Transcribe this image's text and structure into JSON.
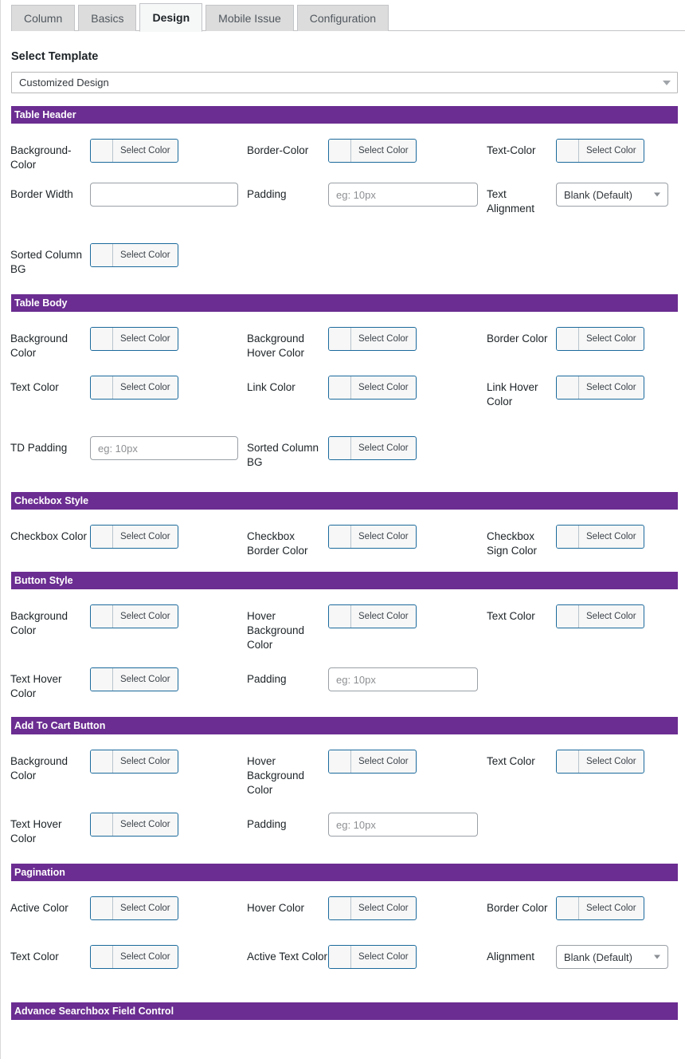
{
  "tabs": [
    {
      "label": "Column",
      "active": false
    },
    {
      "label": "Basics",
      "active": false
    },
    {
      "label": "Design",
      "active": true
    },
    {
      "label": "Mobile Issue",
      "active": false
    },
    {
      "label": "Configuration",
      "active": false
    }
  ],
  "select_template": {
    "heading": "Select Template",
    "value": "Customized Design",
    "caret_icon": "chevron-down-icon"
  },
  "common": {
    "select_color": "Select Color",
    "padding_placeholder": "eg: 10px",
    "blank_default": "Blank (Default)",
    "empty": ""
  },
  "colors": {
    "section_bar_bg": "#6b2d91",
    "section_bar_text": "#ffffff",
    "colorbtn_border": "#1b6a9c",
    "tab_active_bg": "#f6f7f7",
    "tab_inactive_bg": "#dcdcdc"
  },
  "sections": [
    {
      "title": "Table Header",
      "fields": [
        "Background-Color",
        "Border-Color",
        "Text-Color",
        "Border Width",
        "Padding",
        "Text Alignment",
        "Sorted Column BG"
      ]
    },
    {
      "title": "Table Body",
      "fields": [
        "Background Color",
        "Background Hover Color",
        "Border Color",
        "Text Color",
        "Link Color",
        "Link Hover Color",
        "TD Padding",
        "Sorted Column BG"
      ]
    },
    {
      "title": "Checkbox Style",
      "fields": [
        "Checkbox Color",
        "Checkbox Border Color",
        "Checkbox Sign Color"
      ]
    },
    {
      "title": "Button Style",
      "fields": [
        "Background Color",
        "Hover Background Color",
        "Text Color",
        "Text Hover Color",
        "Padding"
      ]
    },
    {
      "title": "Add To Cart Button",
      "fields": [
        "Background Color",
        "Hover Background Color",
        "Text Color",
        "Text Hover Color",
        "Padding"
      ]
    },
    {
      "title": "Pagination",
      "fields": [
        "Active Color",
        "Hover Color",
        "Border Color",
        "Text Color",
        "Active Text Color",
        "Alignment"
      ]
    },
    {
      "title": "Advance Searchbox Field Control",
      "fields": []
    }
  ]
}
